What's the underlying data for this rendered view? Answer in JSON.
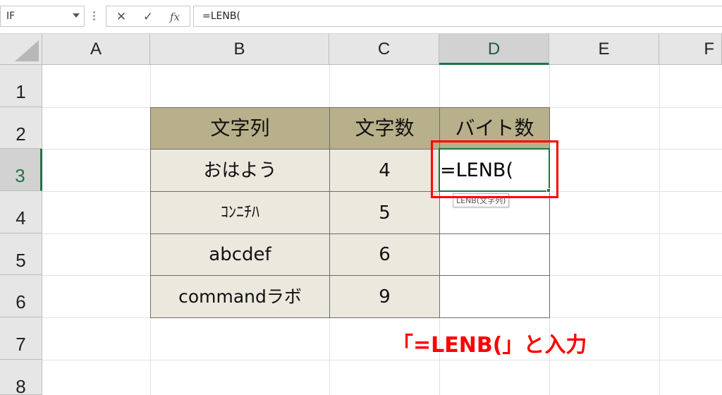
{
  "formula_bar": {
    "name_box": "IF",
    "cancel_icon": "✕",
    "enter_icon": "✓",
    "fx_label": "fx",
    "formula": "=LENB("
  },
  "columns": [
    "A",
    "B",
    "C",
    "D",
    "E",
    "F"
  ],
  "rows": [
    "1",
    "2",
    "3",
    "4",
    "5",
    "6",
    "7",
    "8"
  ],
  "active_column": "D",
  "active_row": "3",
  "table": {
    "headers": [
      "文字列",
      "文字数",
      "バイト数"
    ],
    "rows": [
      {
        "text": "おはよう",
        "chars": "4"
      },
      {
        "text": "ｺﾝﾆﾁﾊ",
        "chars": "5"
      },
      {
        "text": "abcdef",
        "chars": "6"
      },
      {
        "text": "commandラボ",
        "chars": "9"
      }
    ]
  },
  "active_cell": {
    "content": "=LENB(",
    "tooltip": "LENB(文字列)"
  },
  "annotation": "「=LENB(」と入力",
  "colors": {
    "header_fill": "#b8b08a",
    "data_fill": "#ebe8de",
    "excel_green": "#217346",
    "highlight_red": "#ff0000"
  }
}
